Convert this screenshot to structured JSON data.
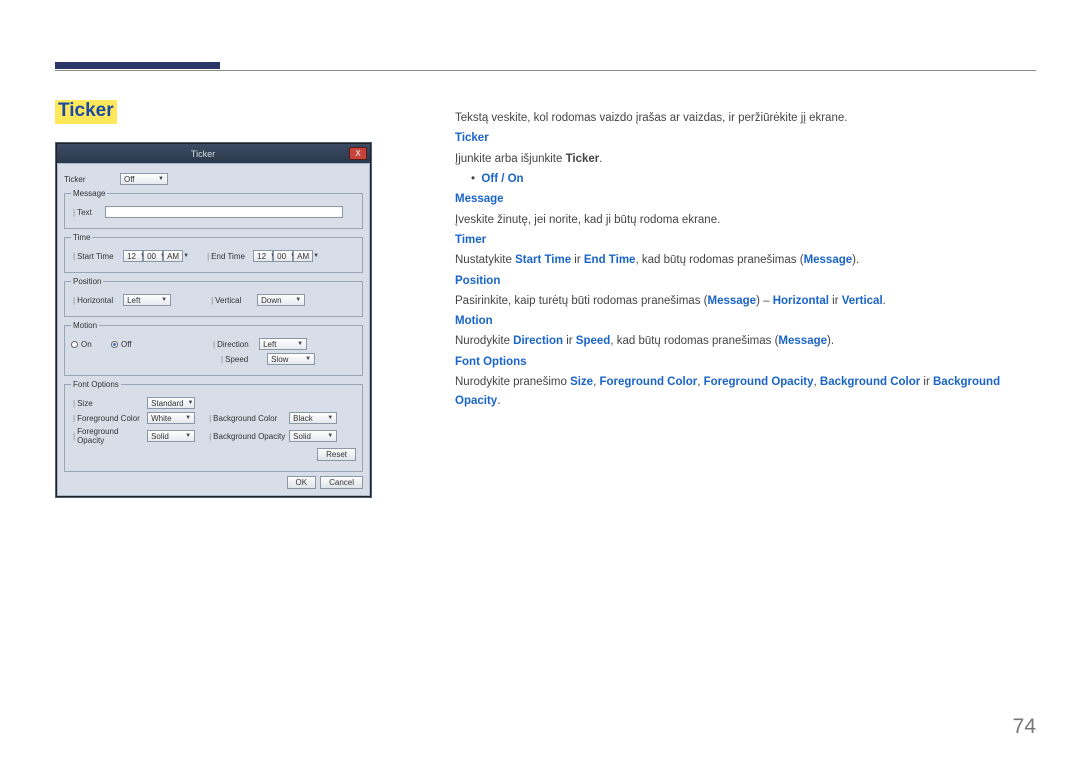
{
  "page_number": "74",
  "heading": "Ticker",
  "dialog": {
    "title": "Ticker",
    "close": "X",
    "ticker": {
      "label": "Ticker",
      "value": "Off"
    },
    "message": {
      "legend": "Message",
      "text_label": "Text"
    },
    "time": {
      "legend": "Time",
      "start_label": "Start Time",
      "end_label": "End Time",
      "hh1": "12",
      "mm1": "00",
      "ap1": "AM",
      "hh2": "12",
      "mm2": "00",
      "ap2": "AM"
    },
    "position": {
      "legend": "Position",
      "h_label": "Horizontal",
      "h_value": "Left",
      "v_label": "Vertical",
      "v_value": "Down"
    },
    "motion": {
      "legend": "Motion",
      "on": "On",
      "off": "Off",
      "dir_label": "Direction",
      "dir_value": "Left",
      "spd_label": "Speed",
      "spd_value": "Slow"
    },
    "font": {
      "legend": "Font Options",
      "size_label": "Size",
      "size_value": "Standard",
      "fgc_label": "Foreground Color",
      "fgc_value": "White",
      "fgo_label": "Foreground Opacity",
      "fgo_value": "Solid",
      "bgc_label": "Background Color",
      "bgc_value": "Black",
      "bgo_label": "Background Opacity",
      "bgo_value": "Solid",
      "reset": "Reset"
    },
    "ok": "OK",
    "cancel": "Cancel"
  },
  "rhs": {
    "p1": "Tekstą veskite, kol rodomas vaizdo įrašas ar vaizdas, ir peržiūrėkite jį ekrane.",
    "ticker_h": "Ticker",
    "p2a": "Įjunkite arba išjunkite ",
    "p2b": "Ticker",
    "bullet": "Off / On",
    "msg_h": "Message",
    "p3": "Įveskite žinutę, jei norite, kad ji būtų rodoma ekrane.",
    "timer_h": "Timer",
    "p4a": "Nustatykite ",
    "p4b": "Start Time",
    "p4c": " ir ",
    "p4d": "End Time",
    "p4e": ", kad būtų rodomas pranešimas (",
    "p4f": "Message",
    "p4g": ").",
    "pos_h": "Position",
    "p5a": "Pasirinkite, kaip turėtų būti rodomas pranešimas (",
    "p5b": "Message",
    "p5c": ") – ",
    "p5d": "Horizontal",
    "p5e": " ir ",
    "p5f": "Vertical",
    "p5g": ".",
    "mot_h": "Motion",
    "p6a": "Nurodykite ",
    "p6b": "Direction",
    "p6c": " ir ",
    "p6d": "Speed",
    "p6e": ", kad būtų rodomas pranešimas (",
    "p6f": "Message",
    "p6g": ").",
    "font_h": "Font Options",
    "p7a": "Nurodykite pranešimo ",
    "p7b": "Size",
    "p7c": ", ",
    "p7d": "Foreground Color",
    "p7e": ", ",
    "p7f": "Foreground Opacity",
    "p7g": ", ",
    "p7h": "Background Color",
    "p7i": " ir ",
    "p7j": "Background Opacity",
    "p7k": "."
  }
}
